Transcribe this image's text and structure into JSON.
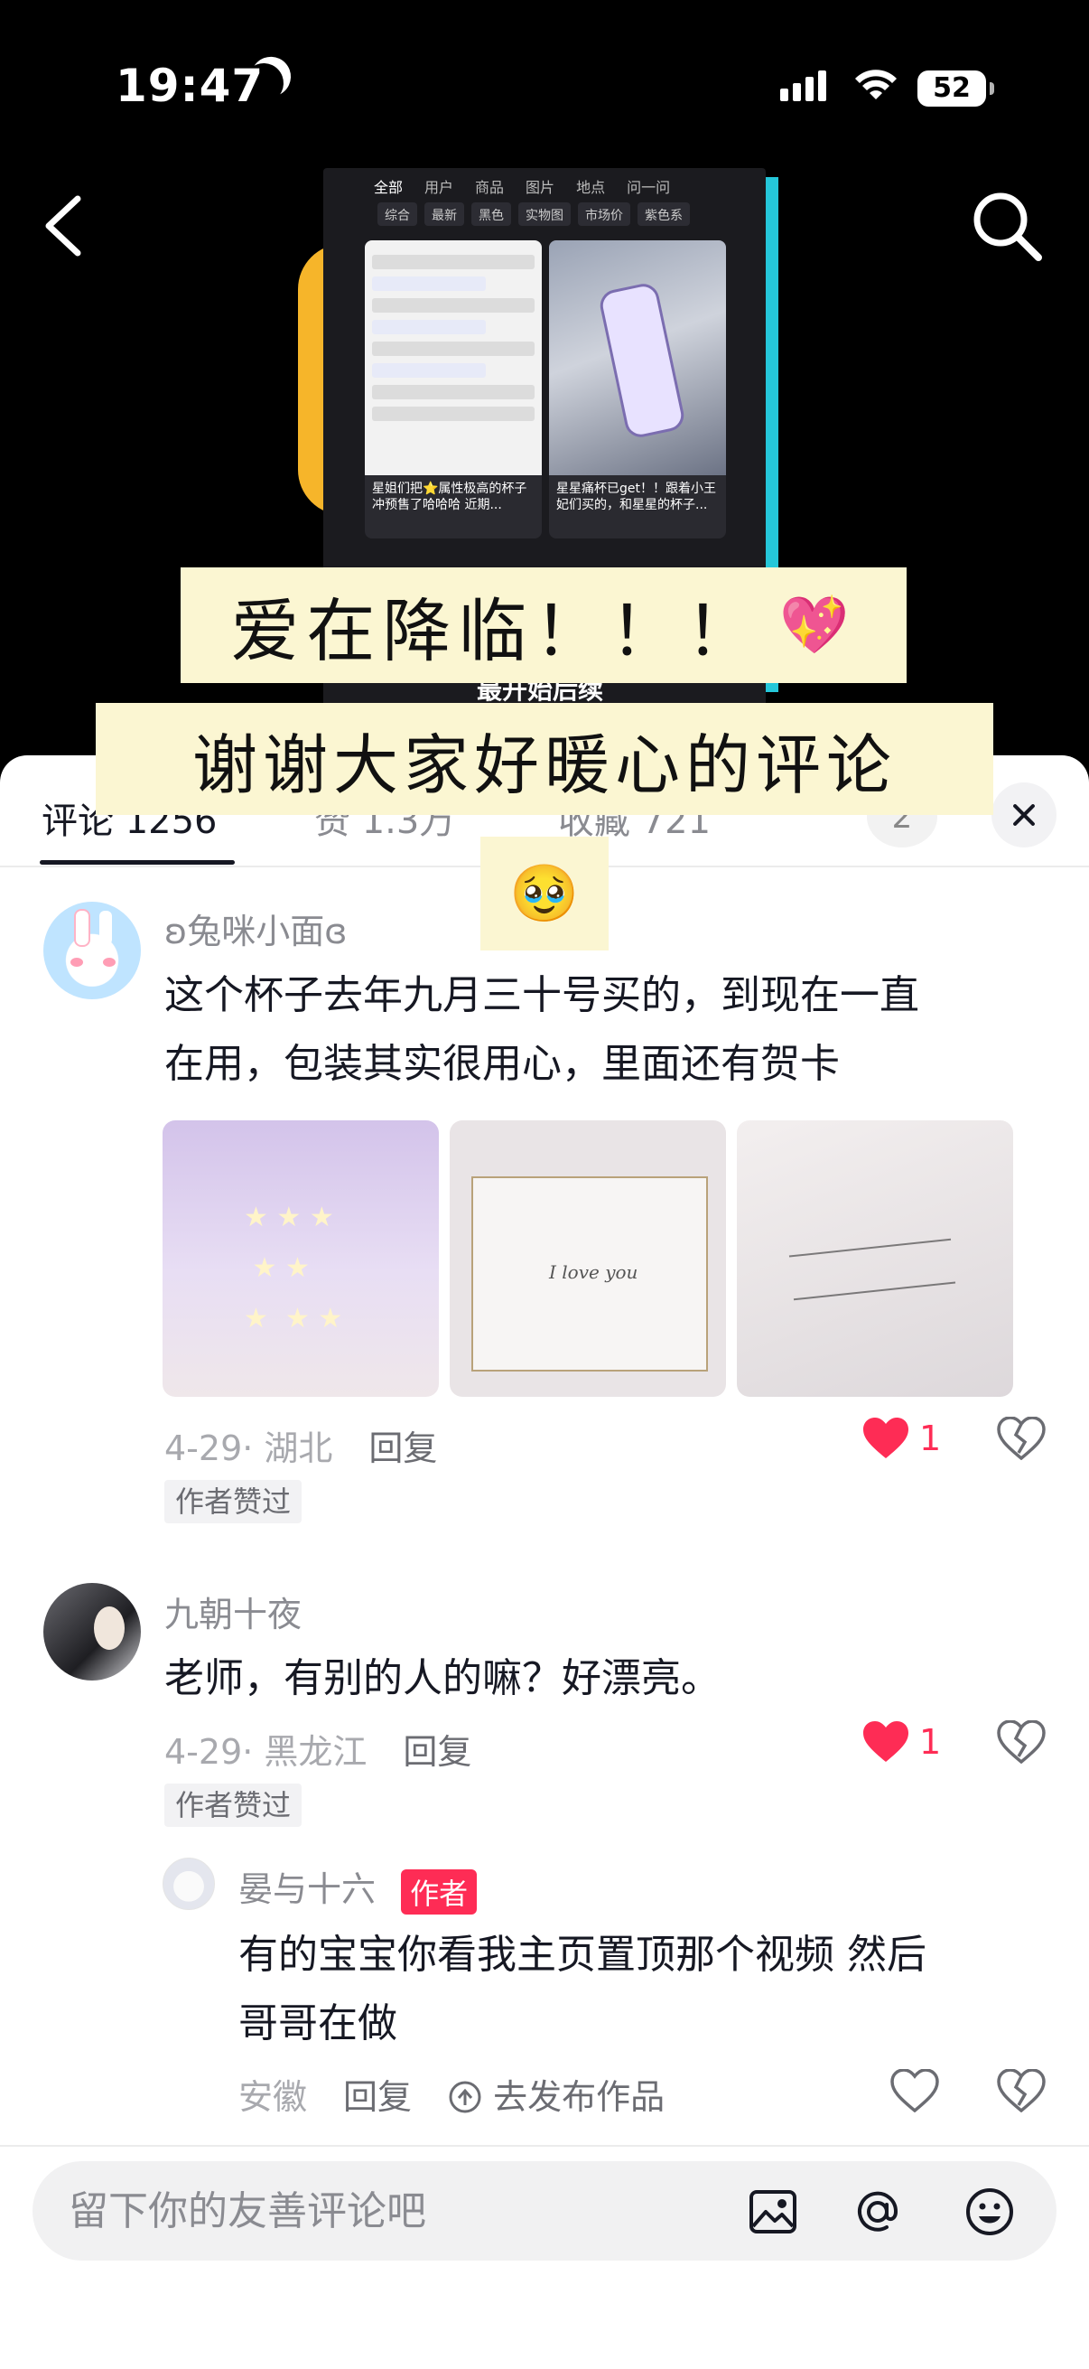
{
  "status_bar": {
    "time": "19:47",
    "battery": "52"
  },
  "video": {
    "screenshot_tabs": [
      "全部",
      "用户",
      "商品",
      "图片",
      "地点",
      "问一问"
    ],
    "screenshot_chips": [
      "综合",
      "最新",
      "黑色",
      "实物图",
      "市场价",
      "紫色系"
    ],
    "card1_caption": "星姐们把⭐属性极高的杯子冲预售了哈哈哈 近期...",
    "card2_caption": "星星痛杯已get！！跟着小王妃们买的，和星星的杯子...",
    "bottom_text": "最开始后续",
    "overlay_line1": "爱在降临！！！",
    "overlay_line1_emoji": "💖",
    "overlay_line2": "谢谢大家好暖心的评论",
    "overlay_emoji": "🥹"
  },
  "sheet": {
    "tabs": [
      {
        "label": "评论 1256"
      },
      {
        "label": "赞 1.3万"
      },
      {
        "label": "收藏 721"
      }
    ],
    "extra_count": "2"
  },
  "comments": [
    {
      "name": "ʚ兔咪小面ɞ",
      "text_line1": "这个杯子去年九月三十号买的，到现在一直",
      "text_line2": "在用，包装其实很用心，里面还有贺卡",
      "photo_card_text": "I love you",
      "date_location": "4-29· 湖北",
      "reply": "回复",
      "liked_badge": "作者赞过",
      "likes": "1"
    },
    {
      "name": "九朝十夜",
      "text_line1": "老师，有别的人的嘛？好漂亮。",
      "date_location": "4-29· 黑龙江",
      "reply": "回复",
      "liked_badge": "作者赞过",
      "likes": "1"
    }
  ],
  "author_reply": {
    "name": "晏与十六",
    "tag": "作者",
    "text_line1": "有的宝宝你看我主页置顶那个视频 然后",
    "text_line2": "哥哥在做",
    "location": "安徽",
    "reply": "回复",
    "publish": "去发布作品"
  },
  "input": {
    "placeholder": "留下你的友善评论吧"
  },
  "colors": {
    "accent": "#fe2c55",
    "overlay_bg": "#fbf6d2"
  }
}
